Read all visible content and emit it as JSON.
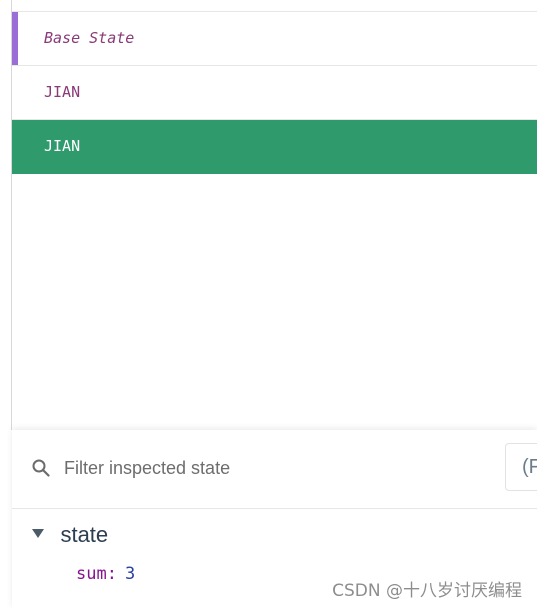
{
  "mutations": {
    "items": [
      {
        "label": "Base State",
        "kind": "base"
      },
      {
        "label": "JIAN",
        "kind": "normal"
      },
      {
        "label": "JIAN",
        "kind": "selected"
      }
    ]
  },
  "inspector": {
    "filter": {
      "placeholder": "Filter inspected state",
      "value": ""
    },
    "action_button_label": "(F",
    "state_section": {
      "label": "state",
      "expanded": true,
      "props": [
        {
          "key": "sum",
          "value": "3"
        }
      ]
    }
  },
  "watermark": "CSDN @十八岁讨厌编程",
  "colors": {
    "selected_row": "#2f9a6c",
    "base_accent": "#9b6dd6",
    "mutation_text": "#8a3a77"
  },
  "icons": {
    "search": "search-icon",
    "toggle": "chevron-down-icon"
  }
}
